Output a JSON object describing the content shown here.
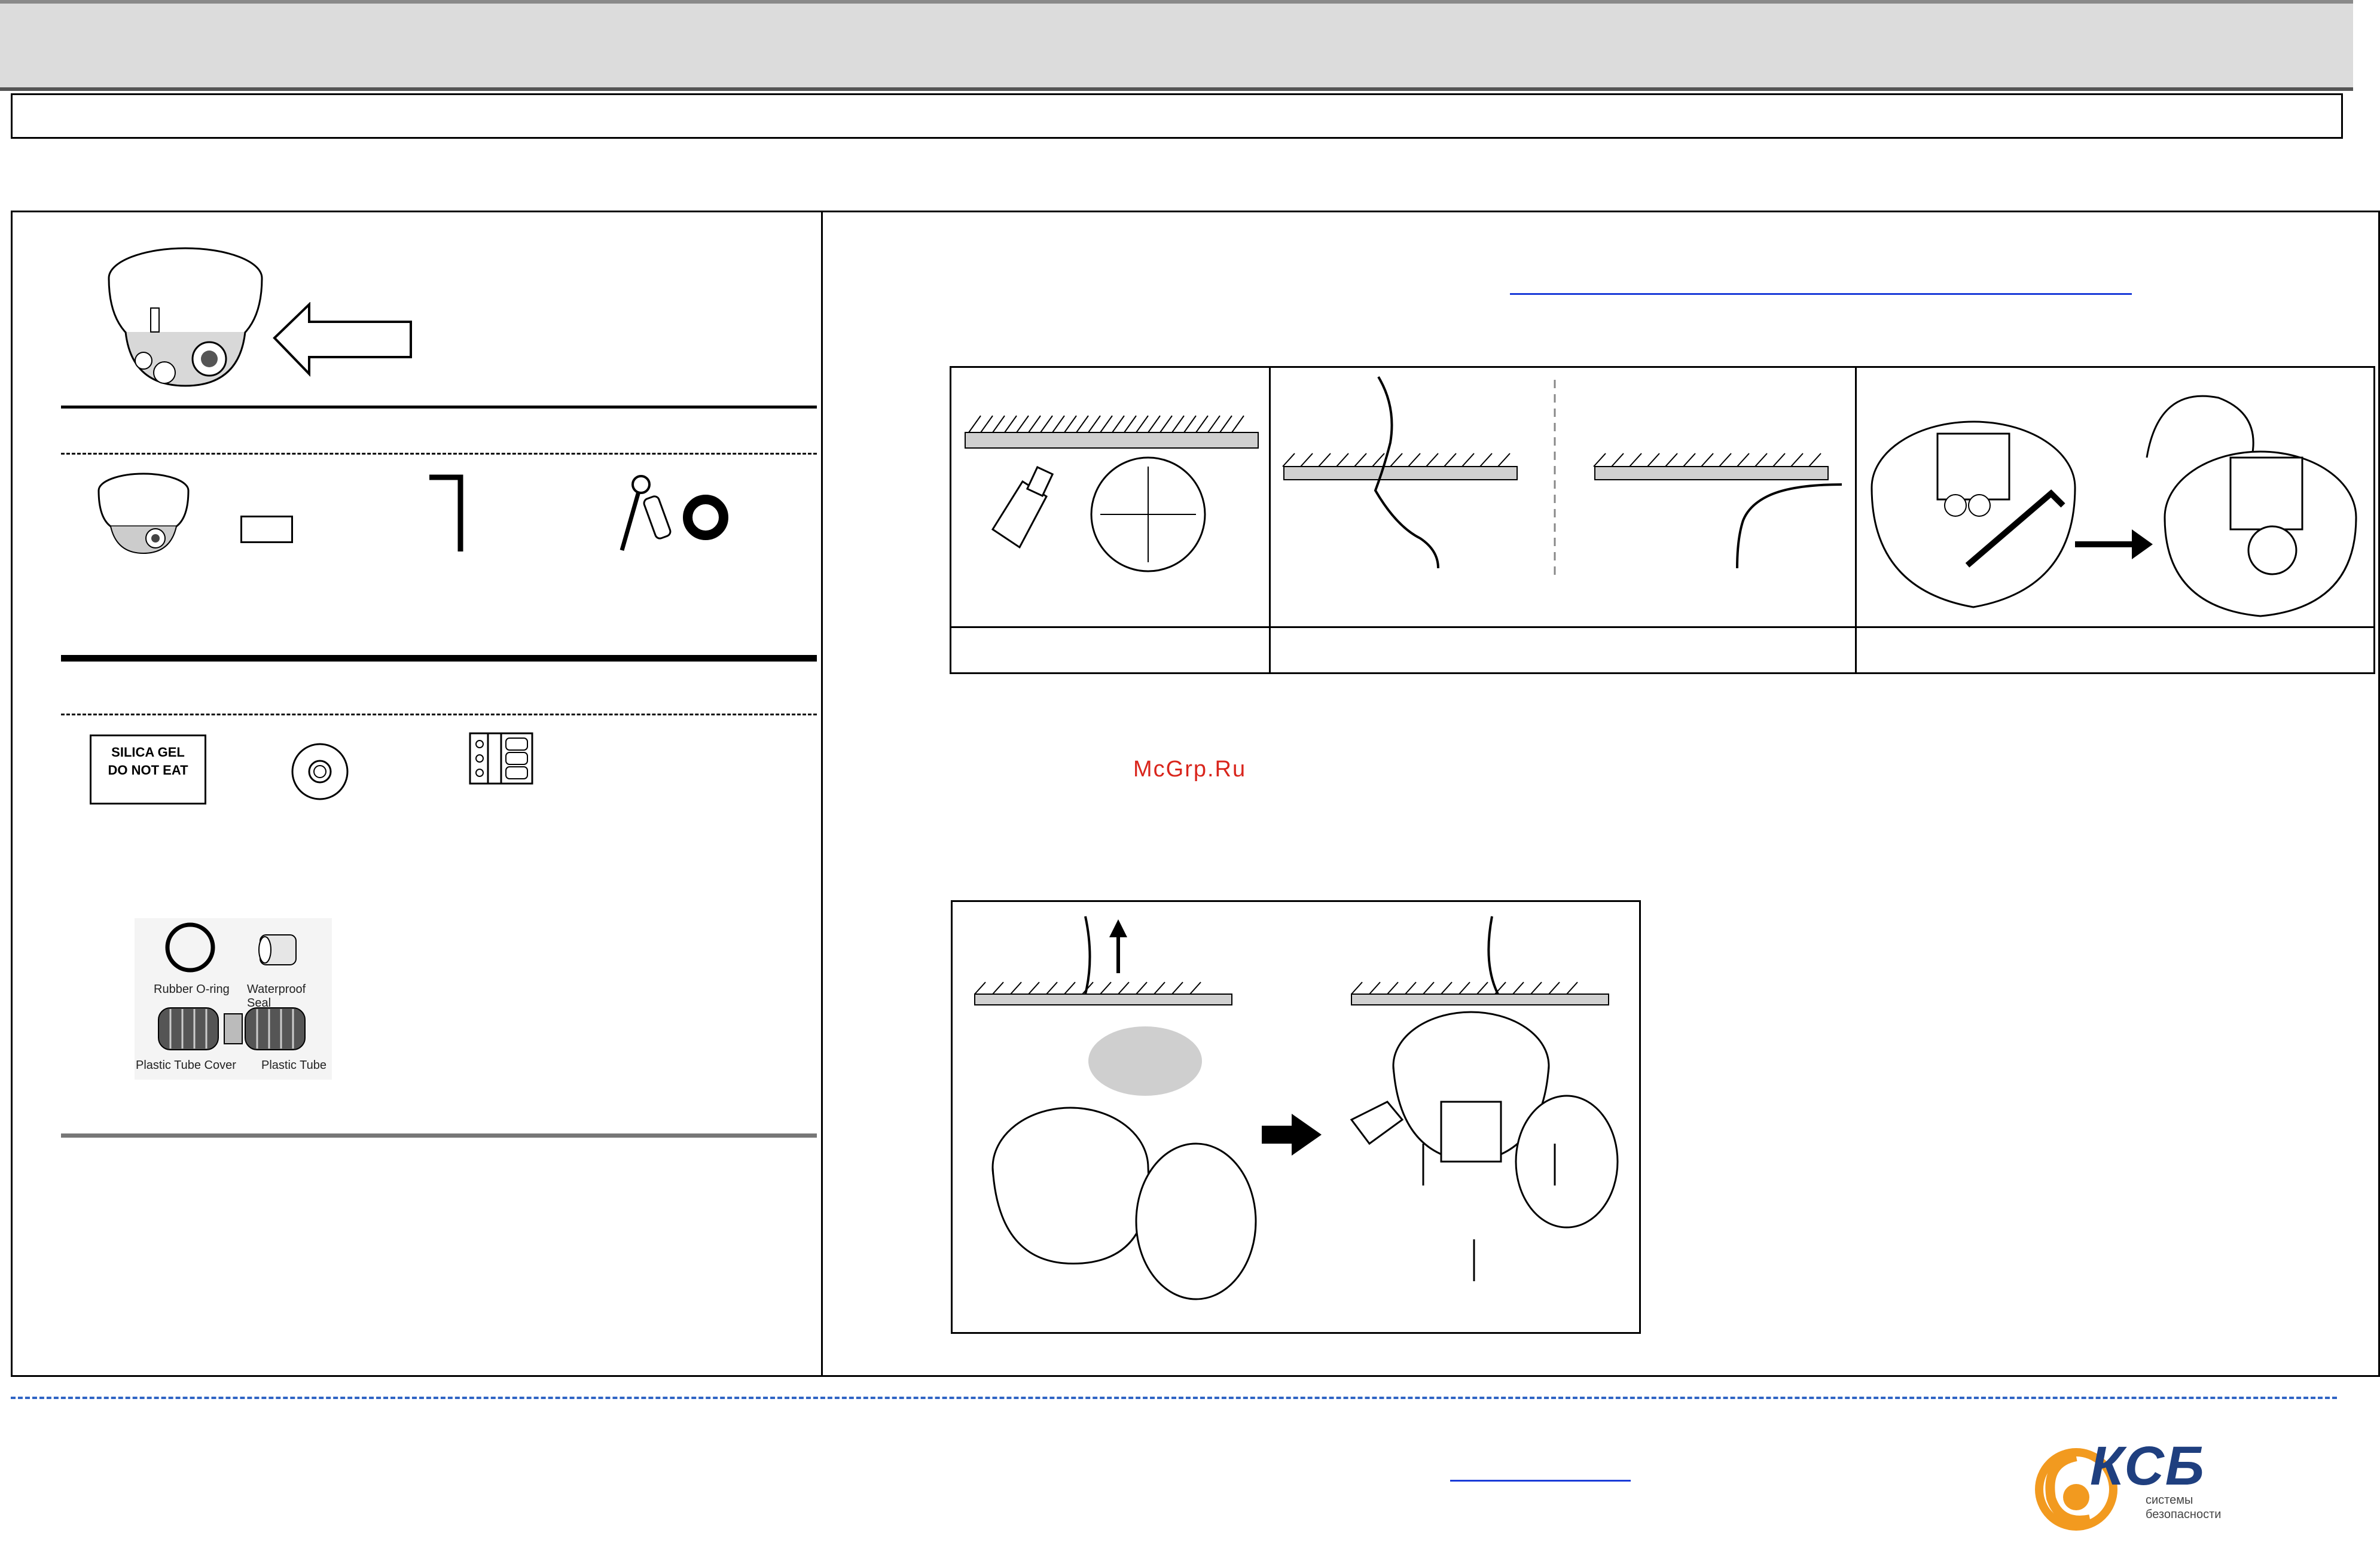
{
  "accessories": {
    "silica_label_line1": "SILICA GEL",
    "silica_label_line2": "DO NOT EAT",
    "rubber_oring_label": "Rubber O-ring",
    "waterproof_seal_label": "Waterproof Seal",
    "plastic_tube_cover_label": "Plastic Tube Cover",
    "plastic_tube_label": "Plastic Tube"
  },
  "watermark": "McGrp.Ru",
  "logo": {
    "brand": "КСБ",
    "tagline_line1": "системы",
    "tagline_line2": "безопасности",
    "accent_color": "#f29a1f",
    "brand_color": "#1f3f7f"
  },
  "colors": {
    "link_blue": "#1a3bd8",
    "footer_dash": "#2f64c4",
    "watermark_red": "#d9251c"
  }
}
